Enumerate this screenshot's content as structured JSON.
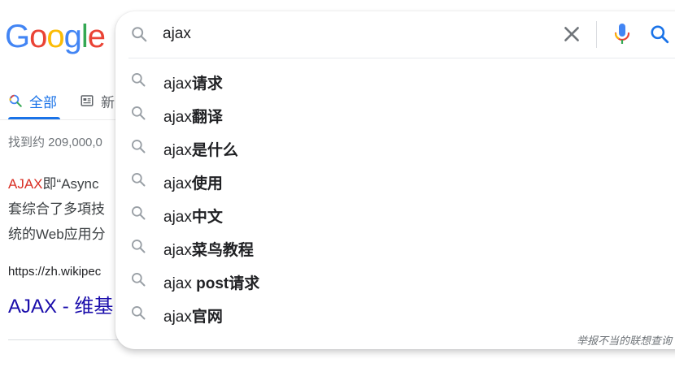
{
  "logo": {
    "letters": [
      "G",
      "o",
      "o",
      "g",
      "l",
      "e"
    ],
    "colors": [
      "#4285f4",
      "#ea4335",
      "#fbbc05",
      "#4285f4",
      "#34a853",
      "#ea4335"
    ]
  },
  "search": {
    "value": "ajax"
  },
  "tabs": [
    {
      "label": "全部",
      "icon": "search-icon",
      "active": true
    },
    {
      "label": "新",
      "icon": "news-icon",
      "active": false
    }
  ],
  "results": {
    "stats": "找到约 209,000,0",
    "snippet": {
      "highlight": "AJAX",
      "line1_rest": "即“Async",
      "line2": "套综合了多項技",
      "line3": "统的Web应用分"
    },
    "url": "https://zh.wikipec",
    "title": "AJAX - 维基"
  },
  "suggestions": [
    {
      "prefix": "ajax",
      "bold": "请求"
    },
    {
      "prefix": "ajax",
      "bold": "翻译"
    },
    {
      "prefix": "ajax",
      "bold": "是什么"
    },
    {
      "prefix": "ajax",
      "bold": "使用"
    },
    {
      "prefix": "ajax",
      "bold": "中文"
    },
    {
      "prefix": "ajax",
      "bold": "菜鸟教程"
    },
    {
      "prefix": "ajax ",
      "bold": "post请求"
    },
    {
      "prefix": "ajax",
      "bold": "官网"
    }
  ],
  "report_link": "举报不当的联想查询",
  "colors": {
    "blue": "#1a73e8",
    "link": "#1a0dab",
    "red": "#d93025",
    "gray_icon": "#9aa0a6"
  }
}
